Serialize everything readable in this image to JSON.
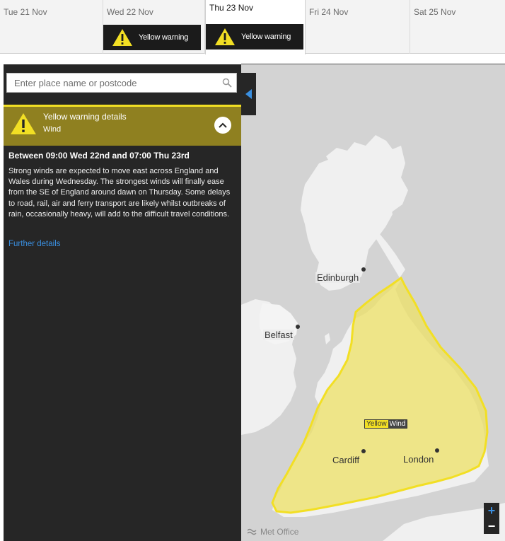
{
  "tabs": [
    {
      "day": "Tue 21 Nov"
    },
    {
      "day": "Wed 22 Nov",
      "warning": "Yellow warning"
    },
    {
      "day": "Thu 23 Nov",
      "warning": "Yellow warning",
      "active": true
    },
    {
      "day": "Fri 24 Nov"
    },
    {
      "day": "Sat 25 Nov"
    }
  ],
  "search": {
    "placeholder": "Enter place name or postcode",
    "icon": "search-icon"
  },
  "details": {
    "title": "Yellow warning details",
    "type": "Wind",
    "period": "Between 09:00 Wed 22nd and 07:00 Thu 23rd",
    "description": "Strong winds are expected to move east across England and Wales during Wednesday. The strongest winds will finally ease from the SE of England around dawn on Thursday. Some delays to road, rail, air and ferry transport are likely whilst outbreaks of rain, occasionally heavy, will add to the difficult travel conditions.",
    "further_link": "Further details"
  },
  "map": {
    "cities": {
      "edinburgh": "Edinburgh",
      "belfast": "Belfast",
      "cardiff": "Cardiff",
      "london": "London"
    },
    "area_label": {
      "level": "Yellow",
      "type": "Wind"
    },
    "zoom_in": "+",
    "zoom_out": "−",
    "brand": "Met Office"
  },
  "colors": {
    "warning_yellow": "#f2df24",
    "panel_bg": "#262626",
    "details_bg": "#8f8020",
    "link_blue": "#3a8fe0"
  }
}
